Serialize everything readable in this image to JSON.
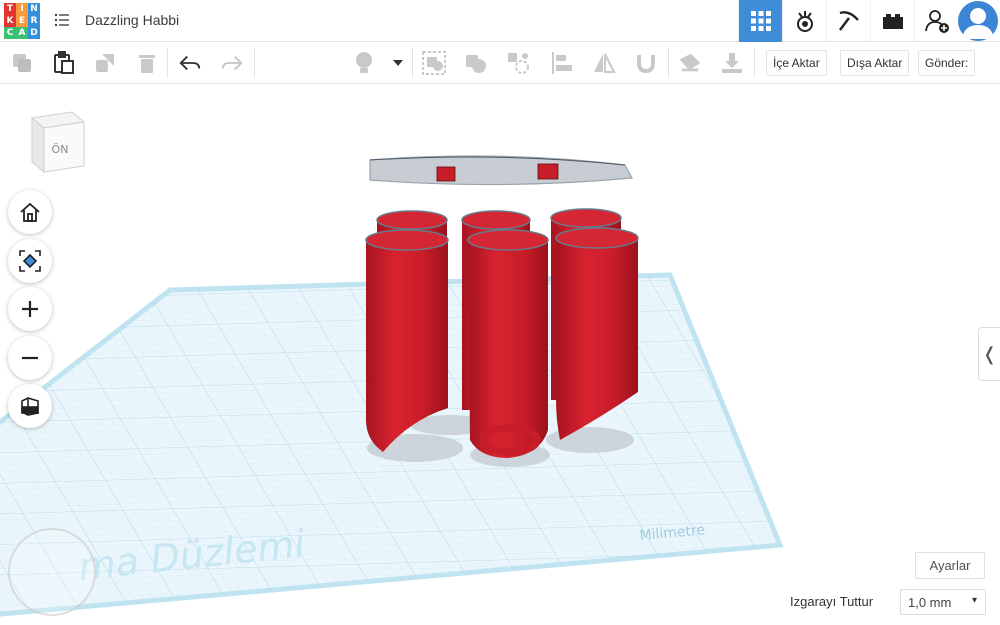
{
  "header": {
    "logo_letters": [
      "T",
      "I",
      "N",
      "K",
      "E",
      "R",
      "C",
      "A",
      "D"
    ],
    "logo_colors": [
      "#e3342f",
      "#f6993f",
      "#3490dc",
      "#e3342f",
      "#f6993f",
      "#3490dc",
      "#38c172",
      "#38c172",
      "#3490dc"
    ],
    "project_title": "Dazzling Habbi",
    "menu_icon": "list-icon",
    "nav_icons": [
      "grid-view-icon",
      "sim-lab-icon",
      "minecraft-pickaxe-icon",
      "bricks-icon",
      "add-user-icon"
    ],
    "active_nav": "grid-view-icon",
    "accent": "#3f8cd9"
  },
  "toolbar": {
    "import_label": "İçe Aktar",
    "export_label": "Dışa Aktar",
    "send_label": "Gönder:",
    "icons": [
      "copy-icon",
      "paste-icon",
      "duplicate-icon",
      "delete-icon",
      "undo-icon",
      "redo-icon",
      "light-icon",
      "dropdown-icon",
      "group-icon",
      "ungroup-icon",
      "align-icon",
      "workplane-icon",
      "mirror-icon",
      "magnet-icon",
      "notes-icon",
      "import-shape-icon"
    ]
  },
  "workplane": {
    "label": "ma Düzlemi",
    "units_label": "Milimetre",
    "viewcube_face": "ÖN",
    "object_color": "#cc1f2c",
    "grid_color": "#bfe3f0"
  },
  "side_controls": [
    "home-icon",
    "fit-view-icon",
    "zoom-in-icon",
    "zoom-out-icon",
    "perspective-icon"
  ],
  "footer": {
    "settings_label": "Ayarlar",
    "snap_label": "Izgarayı Tuttur",
    "snap_value": "1,0 mm"
  }
}
